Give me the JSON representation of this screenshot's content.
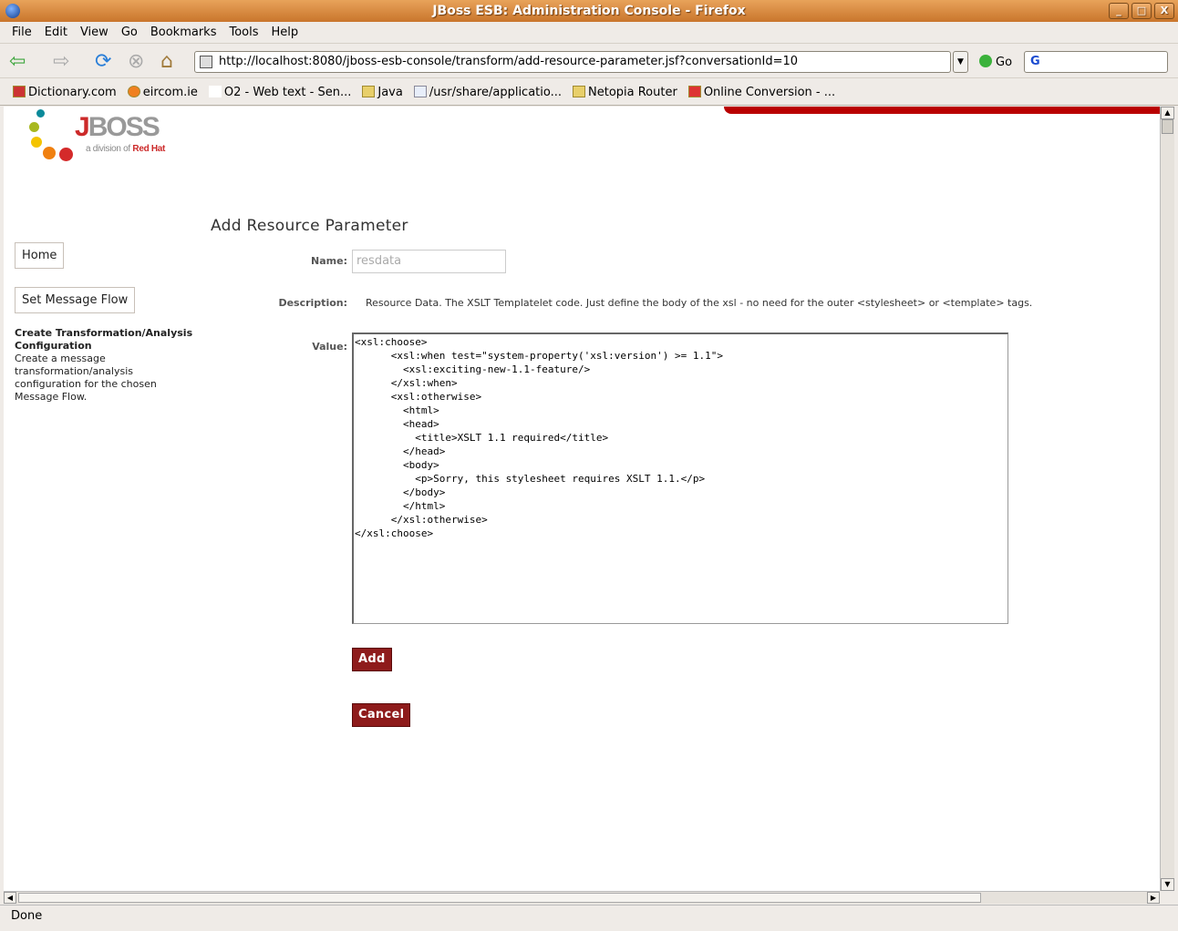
{
  "window": {
    "title": "JBoss ESB: Administration Console - Firefox",
    "controls": [
      "_",
      "□",
      "X"
    ]
  },
  "menu": [
    "File",
    "Edit",
    "View",
    "Go",
    "Bookmarks",
    "Tools",
    "Help"
  ],
  "toolbar": {
    "url": "http://localhost:8080/jboss-esb-console/transform/add-resource-parameter.jsf?conversationId=10",
    "go_label": "Go",
    "search_value": "G"
  },
  "bookmarks": [
    "Dictionary.com",
    "eircom.ie",
    "O2 - Web text - Sen...",
    "Java",
    "/usr/share/applicatio...",
    "Netopia Router",
    "Online Conversion - ..."
  ],
  "logo": {
    "text": "JBoss",
    "tagline": "a division of",
    "brand": "Red Hat"
  },
  "sidebar": {
    "home": "Home",
    "set_flow": "Set Message Flow",
    "section_title": "Create Transformation/Analysis Configuration",
    "section_desc": "Create a message transformation/analysis configuration for the chosen Message Flow."
  },
  "form": {
    "title": "Add Resource Parameter",
    "name_label": "Name:",
    "name_value": "resdata",
    "desc_label": "Description:",
    "description": "Resource Data. The XSLT Templatelet code. Just define the body of the xsl - no need for the outer <stylesheet> or <template> tags.",
    "value_label": "Value:",
    "value": "<xsl:choose>\n      <xsl:when test=\"system-property('xsl:version') >= 1.1\">\n        <xsl:exciting-new-1.1-feature/>\n      </xsl:when>\n      <xsl:otherwise>\n        <html>\n        <head>\n          <title>XSLT 1.1 required</title>\n        </head>\n        <body>\n          <p>Sorry, this stylesheet requires XSLT 1.1.</p>\n        </body>\n        </html>\n      </xsl:otherwise>\n</xsl:choose>",
    "add": "Add",
    "cancel": "Cancel"
  },
  "status": "Done",
  "colors": {
    "button": "#8e1b1b",
    "brand_red": "#cc2a2a",
    "titlebar": "#d88a40"
  }
}
